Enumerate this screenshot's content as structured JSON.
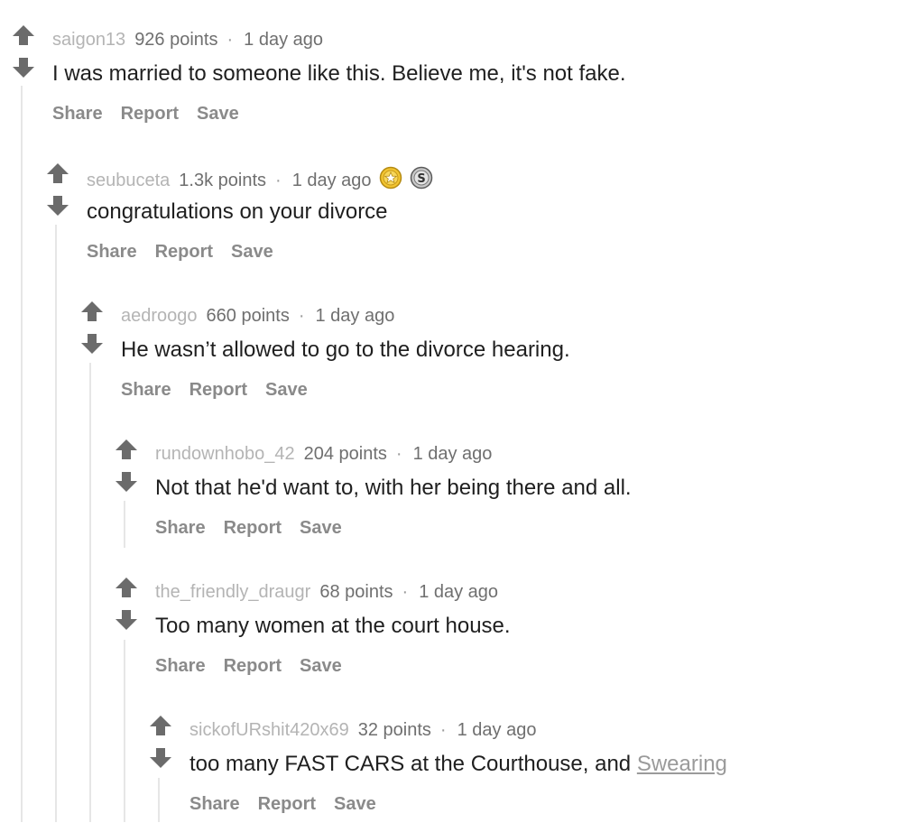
{
  "actions": {
    "share": "Share",
    "report": "Report",
    "save": "Save"
  },
  "comments": [
    {
      "author": "saigon13",
      "points": "926 points",
      "separator": "·",
      "time": "1 day ago",
      "body": "I was married to someone like this. Believe me, it's not fake."
    },
    {
      "author": "seubuceta",
      "points": "1.3k points",
      "separator": "·",
      "time": "1 day ago",
      "body": "congratulations on your divorce",
      "awards": [
        "gold-award-icon",
        "silver-award-icon"
      ]
    },
    {
      "author": "aedroogo",
      "points": "660 points",
      "separator": "·",
      "time": "1 day ago",
      "body": "He wasn’t allowed to go to the divorce hearing."
    },
    {
      "author": "rundownhobo_42",
      "points": "204 points",
      "separator": "·",
      "time": "1 day ago",
      "body": "Not that he'd want to, with her being there and all."
    },
    {
      "author": "the_friendly_draugr",
      "points": "68 points",
      "separator": "·",
      "time": "1 day ago",
      "body": "Too many women at the court house."
    },
    {
      "author": "sickofURshit420x69",
      "points": "32 points",
      "separator": "·",
      "time": "1 day ago",
      "body": "too many FAST CARS at the Courthouse, and ",
      "body_link": "Swearing"
    }
  ],
  "colors": {
    "arrow": "#6b6b6b",
    "author": "#b4b4b4",
    "body": "#1f1f1f",
    "action": "#8a8a8a",
    "link": "#9a9a9a",
    "thread_line": "#e6e6e6",
    "gold_award": "#f2c430",
    "silver_award": "#c9c9c9"
  }
}
